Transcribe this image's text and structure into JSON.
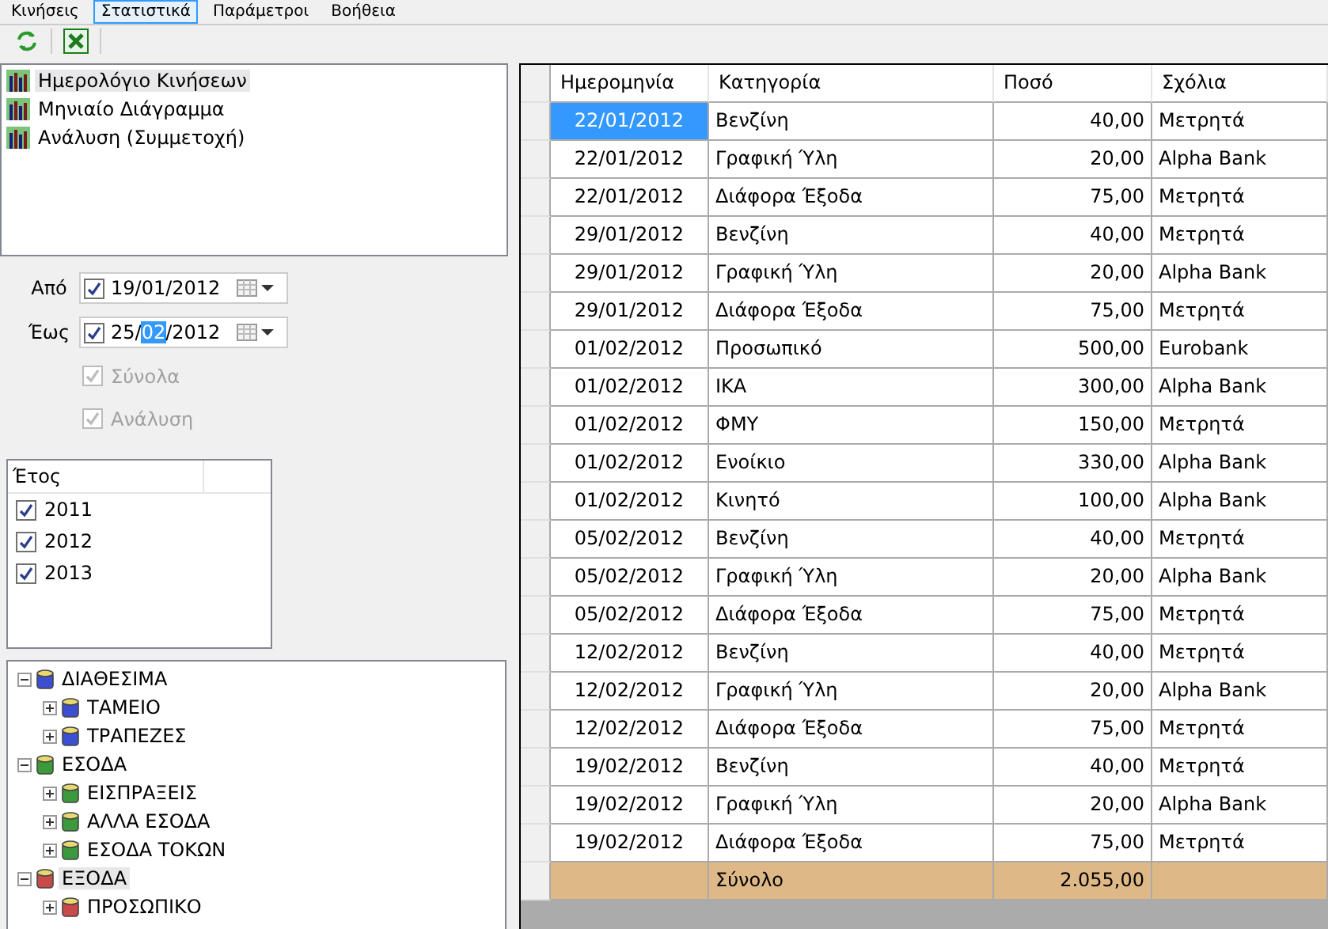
{
  "menu": [
    {
      "label": "Κινήσεις",
      "selected": false
    },
    {
      "label": "Στατιστικά",
      "selected": true
    },
    {
      "label": "Παράμετροι",
      "selected": false
    },
    {
      "label": "Βοήθεια",
      "selected": false
    }
  ],
  "reports": [
    {
      "label": "Ημερολόγιο Κινήσεων",
      "selected": true
    },
    {
      "label": "Μηνιαίο Διάγραμμα",
      "selected": false
    },
    {
      "label": "Ανάλυση (Συμμετοχή)",
      "selected": false
    }
  ],
  "date_from": {
    "label": "Από",
    "checked": true,
    "segments": [
      {
        "text": "19/",
        "selected": false
      },
      {
        "text": "01",
        "selected": false
      },
      {
        "text": "/2012",
        "selected": false
      }
    ]
  },
  "date_to": {
    "label": "Έως",
    "checked": true,
    "segments": [
      {
        "text": "25/",
        "selected": false
      },
      {
        "text": "02",
        "selected": true
      },
      {
        "text": "/2012",
        "selected": false
      }
    ]
  },
  "options": [
    {
      "label": "Σύνολα",
      "checked": true,
      "disabled": true
    },
    {
      "label": "Ανάλυση",
      "checked": true,
      "disabled": true
    }
  ],
  "years": {
    "column": "Έτος",
    "items": [
      {
        "label": "2011",
        "checked": true
      },
      {
        "label": "2012",
        "checked": true
      },
      {
        "label": "2013",
        "checked": true
      }
    ]
  },
  "tree": [
    {
      "label": "ΔΙΑΘΕΣΙΜΑ",
      "color": "#3b4fd0",
      "expanded": true,
      "selected": false,
      "children": [
        {
          "label": "ΤΑΜΕΙΟ",
          "color": "#3b4fd0",
          "expanded": false,
          "selected": false
        },
        {
          "label": "ΤΡΑΠΕΖΕΣ",
          "color": "#3b4fd0",
          "expanded": false,
          "selected": false
        }
      ]
    },
    {
      "label": "ΕΣΟΔΑ",
      "color": "#3c9a3c",
      "expanded": true,
      "selected": false,
      "children": [
        {
          "label": "ΕΙΣΠΡΑΞΕΙΣ",
          "color": "#3c9a3c",
          "expanded": false,
          "selected": false
        },
        {
          "label": "ΑΛΛΑ ΕΣΟΔΑ",
          "color": "#3c9a3c",
          "expanded": false,
          "selected": false
        },
        {
          "label": "ΕΣΟΔΑ ΤΟΚΩΝ",
          "color": "#3c9a3c",
          "expanded": false,
          "selected": false
        }
      ]
    },
    {
      "label": "ΕΞΟΔΑ",
      "color": "#c84a4a",
      "expanded": true,
      "selected": true,
      "children": [
        {
          "label": "ΠΡΟΣΩΠΙΚΟ",
          "color": "#c84a4a",
          "expanded": false,
          "selected": false
        }
      ]
    }
  ],
  "table": {
    "columns": [
      "Ημερομηνία",
      "Κατηγορία",
      "Ποσό",
      "Σχόλια"
    ],
    "rows": [
      {
        "date": "22/01/2012",
        "category": "Βενζίνη",
        "amount": "40,00",
        "comment": "Μετρητά",
        "selected": true
      },
      {
        "date": "22/01/2012",
        "category": "Γραφική Ύλη",
        "amount": "20,00",
        "comment": "Alpha Bank",
        "selected": false
      },
      {
        "date": "22/01/2012",
        "category": "Διάφορα Έξοδα",
        "amount": "75,00",
        "comment": "Μετρητά",
        "selected": false
      },
      {
        "date": "29/01/2012",
        "category": "Βενζίνη",
        "amount": "40,00",
        "comment": "Μετρητά",
        "selected": false
      },
      {
        "date": "29/01/2012",
        "category": "Γραφική Ύλη",
        "amount": "20,00",
        "comment": "Alpha Bank",
        "selected": false
      },
      {
        "date": "29/01/2012",
        "category": "Διάφορα Έξοδα",
        "amount": "75,00",
        "comment": "Μετρητά",
        "selected": false
      },
      {
        "date": "01/02/2012",
        "category": "Προσωπικό",
        "amount": "500,00",
        "comment": "Eurobank",
        "selected": false
      },
      {
        "date": "01/02/2012",
        "category": "ΙΚΑ",
        "amount": "300,00",
        "comment": "Alpha Bank",
        "selected": false
      },
      {
        "date": "01/02/2012",
        "category": "ΦΜΥ",
        "amount": "150,00",
        "comment": "Μετρητά",
        "selected": false
      },
      {
        "date": "01/02/2012",
        "category": "Ενοίκιο",
        "amount": "330,00",
        "comment": "Alpha Bank",
        "selected": false
      },
      {
        "date": "01/02/2012",
        "category": "Κινητό",
        "amount": "100,00",
        "comment": "Alpha Bank",
        "selected": false
      },
      {
        "date": "05/02/2012",
        "category": "Βενζίνη",
        "amount": "40,00",
        "comment": "Μετρητά",
        "selected": false
      },
      {
        "date": "05/02/2012",
        "category": "Γραφική Ύλη",
        "amount": "20,00",
        "comment": "Alpha Bank",
        "selected": false
      },
      {
        "date": "05/02/2012",
        "category": "Διάφορα Έξοδα",
        "amount": "75,00",
        "comment": "Μετρητά",
        "selected": false
      },
      {
        "date": "12/02/2012",
        "category": "Βενζίνη",
        "amount": "40,00",
        "comment": "Μετρητά",
        "selected": false
      },
      {
        "date": "12/02/2012",
        "category": "Γραφική Ύλη",
        "amount": "20,00",
        "comment": "Alpha Bank",
        "selected": false
      },
      {
        "date": "12/02/2012",
        "category": "Διάφορα Έξοδα",
        "amount": "75,00",
        "comment": "Μετρητά",
        "selected": false
      },
      {
        "date": "19/02/2012",
        "category": "Βενζίνη",
        "amount": "40,00",
        "comment": "Μετρητά",
        "selected": false
      },
      {
        "date": "19/02/2012",
        "category": "Γραφική Ύλη",
        "amount": "20,00",
        "comment": "Alpha Bank",
        "selected": false
      },
      {
        "date": "19/02/2012",
        "category": "Διάφορα Έξοδα",
        "amount": "75,00",
        "comment": "Μετρητά",
        "selected": false
      }
    ],
    "total": {
      "label": "Σύνολο",
      "amount": "2.055,00"
    }
  }
}
